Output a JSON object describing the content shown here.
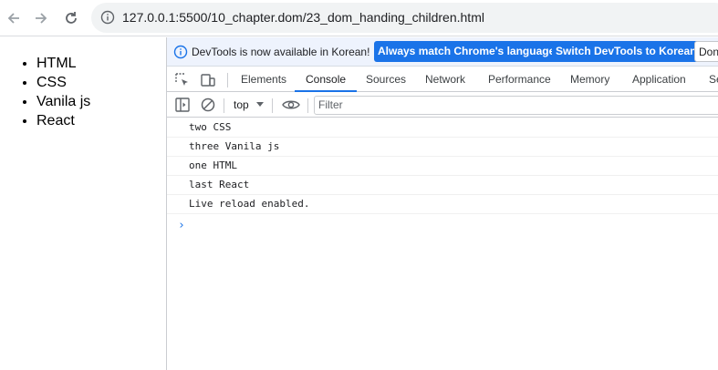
{
  "browser": {
    "url": "127.0.0.1:5500/10_chapter.dom/23_dom_handing_children.html"
  },
  "page": {
    "list_items": [
      "HTML",
      "CSS",
      "Vanila js",
      "React"
    ]
  },
  "devtools": {
    "infobar": {
      "message": "DevTools is now available in Korean!",
      "match_button": "Always match Chrome's language",
      "switch_button": "Switch DevTools to Korean",
      "dont_button": "Don't"
    },
    "tabs": [
      "Elements",
      "Console",
      "Sources",
      "Network",
      "Performance",
      "Memory",
      "Application",
      "Se"
    ],
    "active_tab": "Console",
    "context": "top",
    "filter_placeholder": "Filter",
    "console_lines": [
      "two CSS",
      "three Vanila js",
      "one HTML",
      "last React",
      "Live reload enabled."
    ],
    "prompt_symbol": "›"
  },
  "colors": {
    "accent": "#1a73e8",
    "infobar_bg": "#eef3fd"
  }
}
